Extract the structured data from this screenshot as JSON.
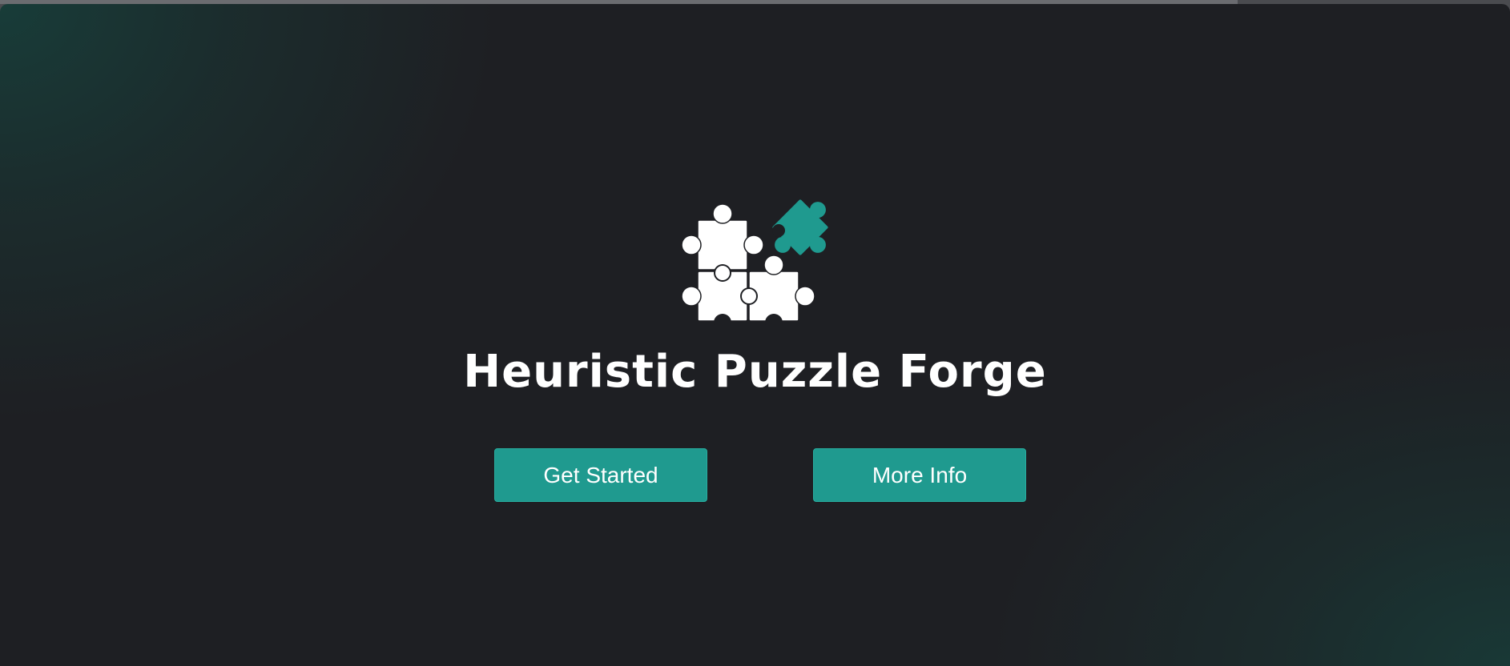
{
  "app": {
    "title": "Heuristic Puzzle Forge"
  },
  "logo": {
    "icon": "puzzle-pieces-icon",
    "colors": {
      "pieces": "#ffffff",
      "accent_piece": "#1f9a8f"
    }
  },
  "actions": {
    "get_started_label": "Get Started",
    "more_info_label": "More Info"
  },
  "theme": {
    "background": "#1e1f23",
    "accent": "#1f9a8f",
    "glow": "#164640",
    "text": "#ffffff"
  }
}
